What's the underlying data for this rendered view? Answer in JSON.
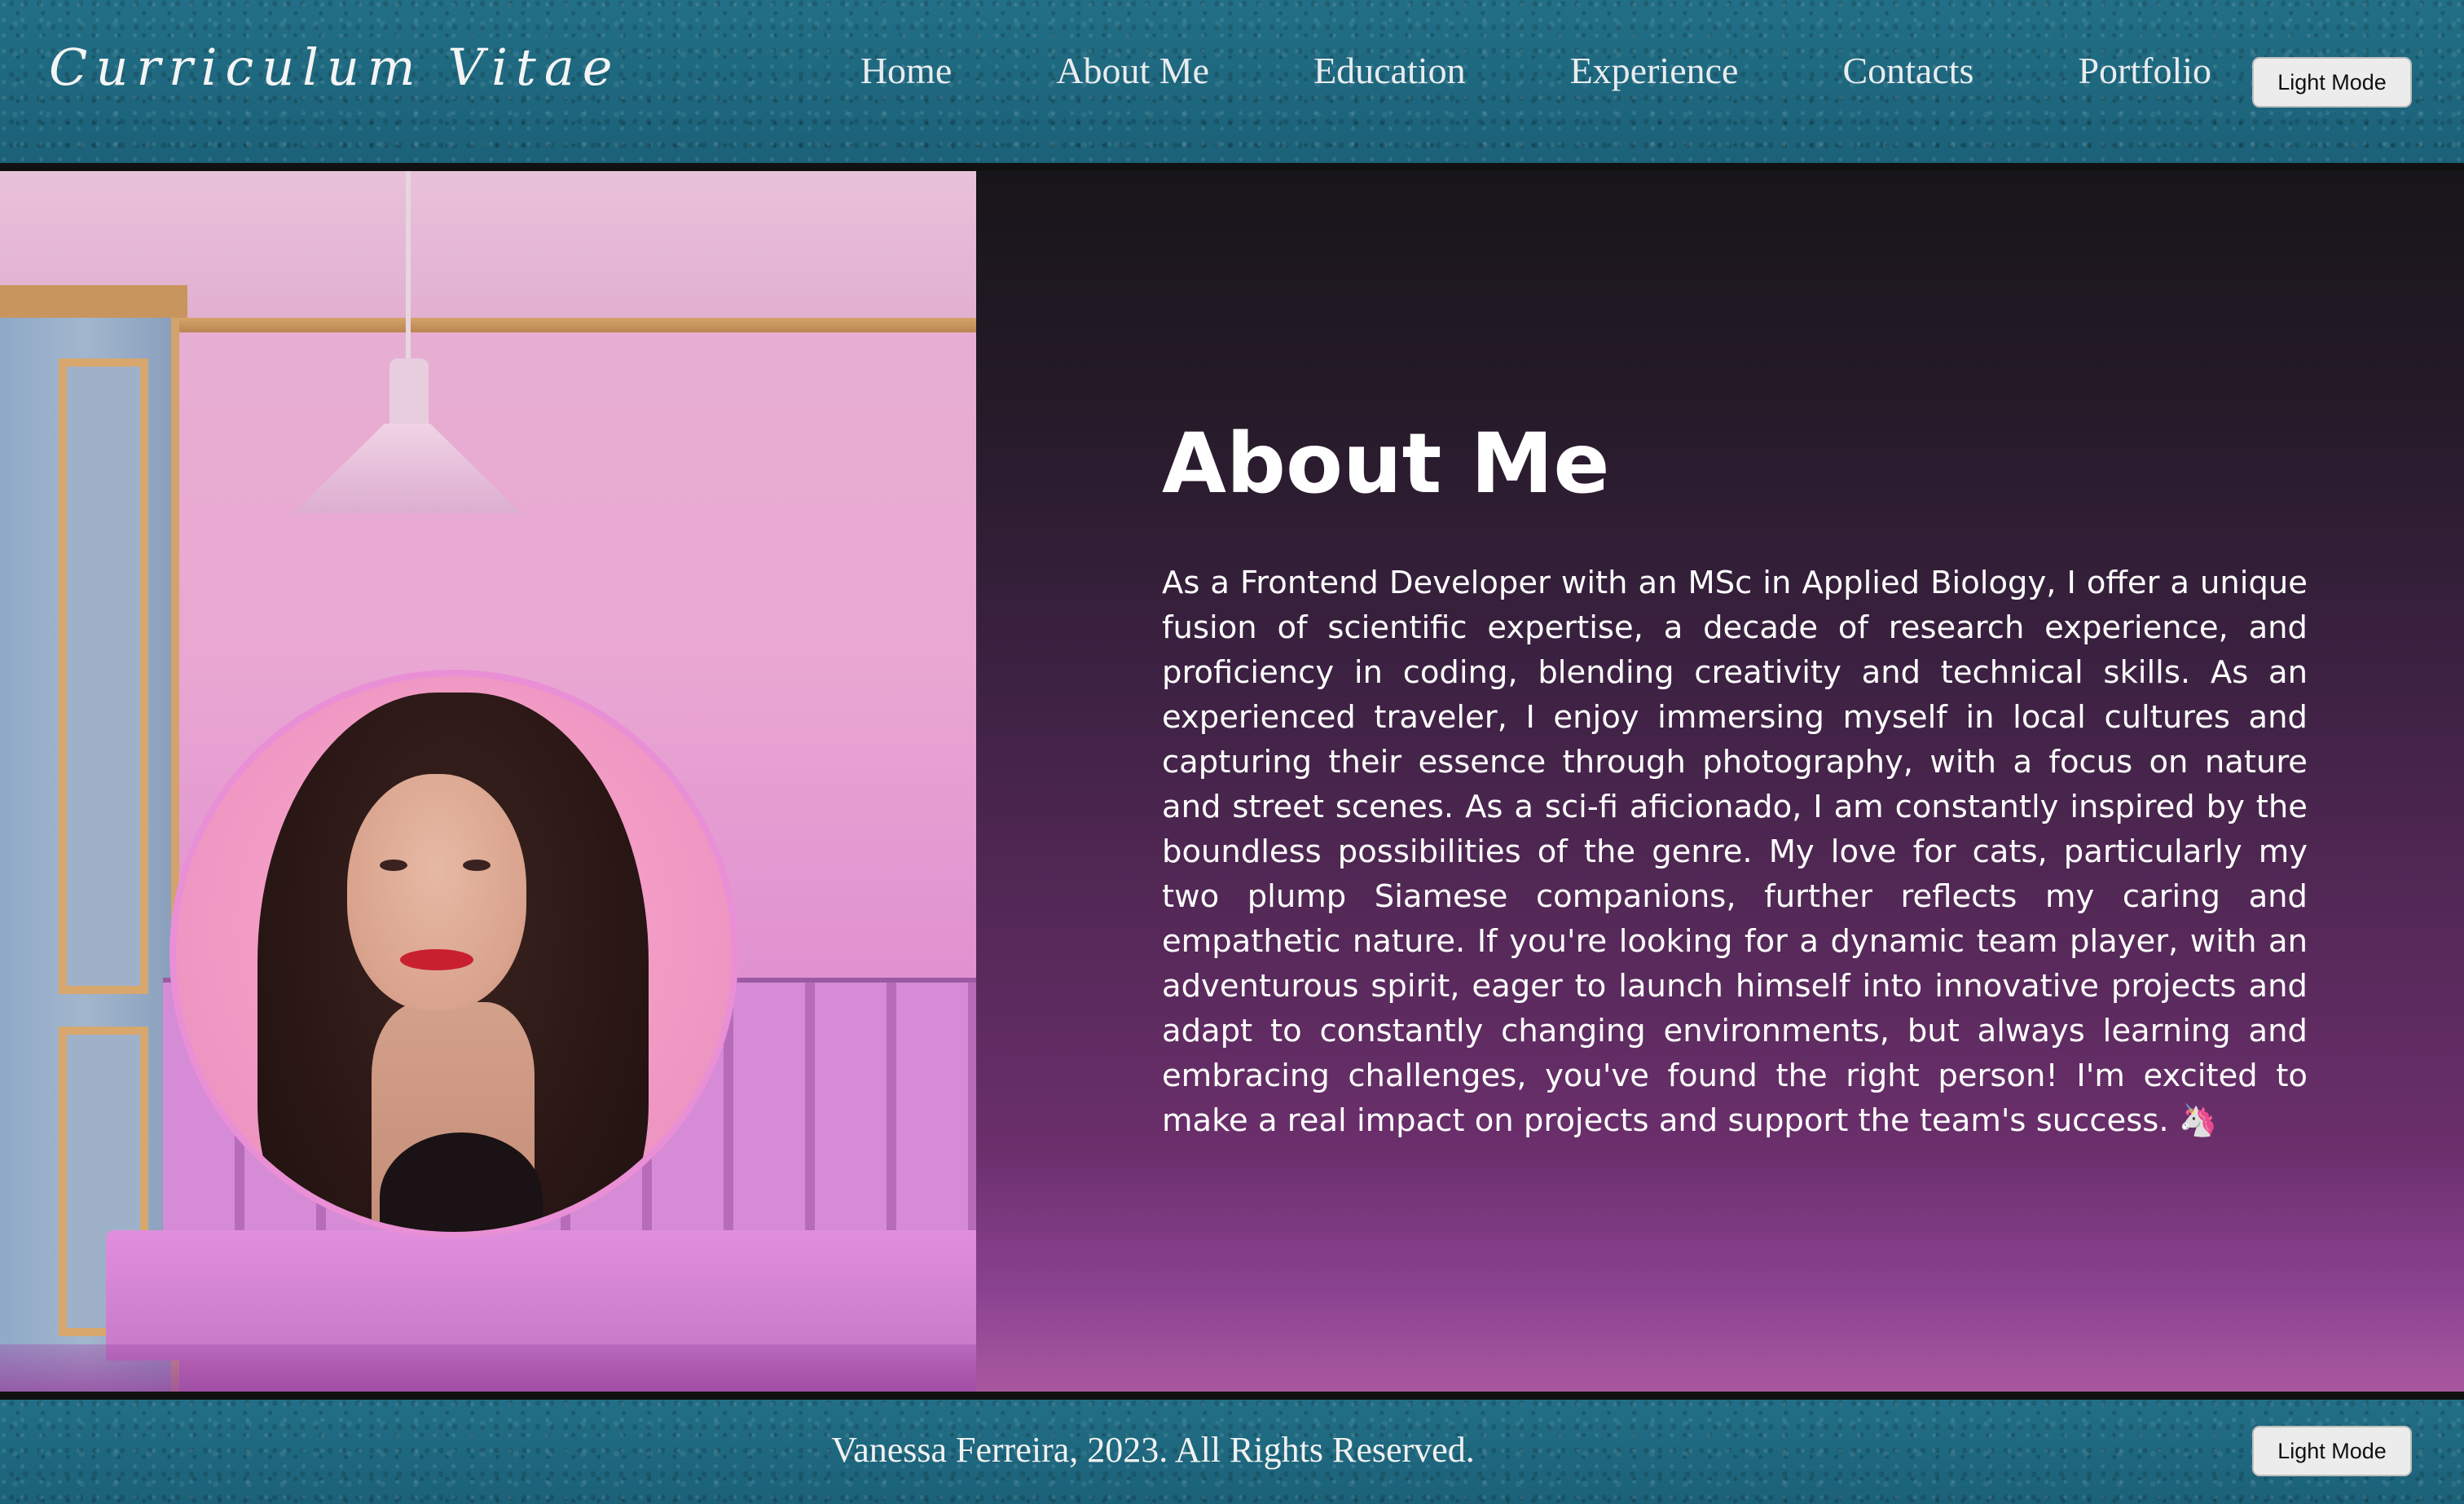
{
  "header": {
    "logo": "Curriculum Vitae",
    "nav": [
      {
        "label": "Home"
      },
      {
        "label": "About Me"
      },
      {
        "label": "Education"
      },
      {
        "label": "Experience"
      },
      {
        "label": "Contacts"
      },
      {
        "label": "Portfolio"
      }
    ],
    "mode_button": "Light Mode"
  },
  "main": {
    "title": "About Me",
    "body": "As a Frontend Developer with an MSc in Applied Biology, I offer a unique fusion of scientific expertise, a decade of research experience, and proficiency in coding, blending creativity and technical skills. As an experienced traveler, I enjoy immersing myself in local cultures and capturing their essence through photography, with a focus on nature and street scenes. As a sci-fi aficionado, I am constantly inspired by the boundless possibilities of the genre. My love for cats, particularly my two plump Siamese companions, further reflects my caring and empathetic nature. If you're looking for a dynamic team player, with an adventurous spirit, eager to launch himself into innovative projects and adapt to constantly changing environments, but always learning and embracing challenges, you've found the right person! I'm excited to make a real impact on projects and support the team's success. 🦄"
  },
  "footer": {
    "copyright": "Vanessa Ferreira, 2023. All Rights Reserved.",
    "mode_button": "Light Mode"
  },
  "colors": {
    "header_bg": "#1f6a82",
    "panel_gradient_top": "#18151a",
    "panel_gradient_bottom": "#a9589f",
    "avatar_border": "#e98fd6"
  }
}
